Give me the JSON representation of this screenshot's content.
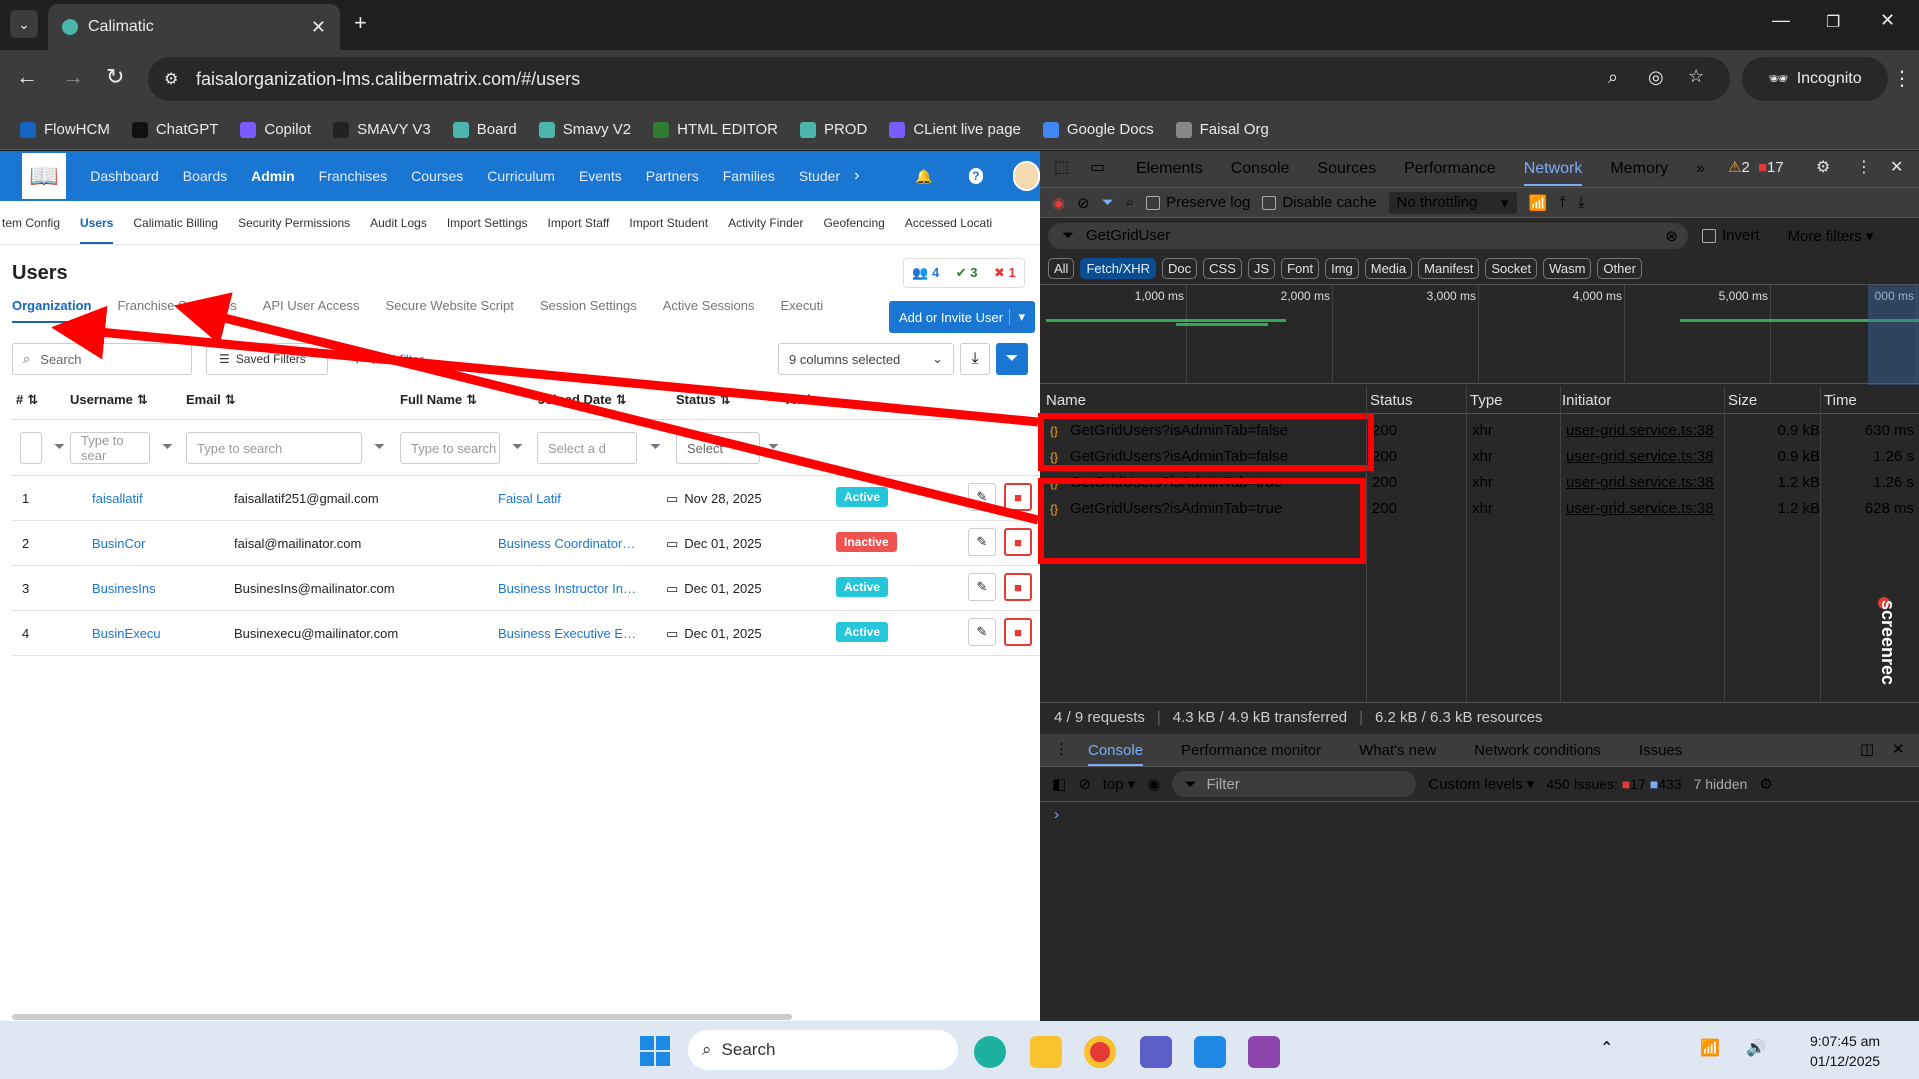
{
  "browser": {
    "tab_title": "Calimatic",
    "url": "faisalorganization-lms.calibermatrix.com/#/users",
    "incognito_label": "Incognito",
    "bookmarks": [
      {
        "label": "FlowHCM",
        "color": "#1565c0"
      },
      {
        "label": "ChatGPT",
        "color": "#111111"
      },
      {
        "label": "Copilot",
        "color": "#7b5cff"
      },
      {
        "label": "SMAVY V3",
        "color": "#222222"
      },
      {
        "label": "Board",
        "color": "#4db6ac"
      },
      {
        "label": "Smavy V2",
        "color": "#4db6ac"
      },
      {
        "label": "HTML EDITOR",
        "color": "#2e7d32"
      },
      {
        "label": "PROD",
        "color": "#4db6ac"
      },
      {
        "label": "CLient live page",
        "color": "#7b5cff"
      },
      {
        "label": "Google Docs",
        "color": "#4285f4"
      },
      {
        "label": "Faisal Org",
        "color": "#888888"
      }
    ]
  },
  "app": {
    "nav": [
      "Dashboard",
      "Boards",
      "Admin",
      "Franchises",
      "Courses",
      "Curriculum",
      "Events",
      "Partners",
      "Families",
      "Studer"
    ],
    "nav_active": "Admin",
    "subnav": [
      "tem Config",
      "Users",
      "Calimatic Billing",
      "Security Permissions",
      "Audit Logs",
      "Import Settings",
      "Import Staff",
      "Import Student",
      "Activity Finder",
      "Geofencing",
      "Accessed Locati"
    ],
    "subnav_active": "Users",
    "page_title": "Users",
    "counts": {
      "total": "4",
      "active": "3",
      "inactive": "1"
    },
    "tabs": [
      "Organization",
      "Franchise S",
      "oles",
      "API User Access",
      "Secure Website Script",
      "Session Settings",
      "Active Sessions",
      "Executi"
    ],
    "invite_button": "Add or Invite User",
    "search_placeholder": "Search",
    "saved_filters": "Saved Filters",
    "add_filter": "Add filter",
    "columns_selected": "9 columns selected",
    "columns": [
      "#",
      "Username",
      "Email",
      "Full Name",
      "Joined Date",
      "Status",
      "Action"
    ],
    "filter_placeholders": {
      "username": "Type to sear",
      "email": "Type to search",
      "fullname": "Type to search",
      "date": "Select a d",
      "status": "Select"
    },
    "rows": [
      {
        "n": "1",
        "username": "faisallatif",
        "email": "faisallatif251@gmail.com",
        "fullname": "Faisal Latif",
        "date": "Nov 28, 2025",
        "status": "Active"
      },
      {
        "n": "2",
        "username": "BusinCor",
        "email": "faisal@mailinator.com",
        "fullname": "Business Coordinator…",
        "date": "Dec 01, 2025",
        "status": "Inactive"
      },
      {
        "n": "3",
        "username": "BusinesIns",
        "email": "BusinesIns@mailinator.com",
        "fullname": "Business Instructor In…",
        "date": "Dec 01, 2025",
        "status": "Active"
      },
      {
        "n": "4",
        "username": "BusinExecu",
        "email": "Businexecu@mailinator.com",
        "fullname": "Business Executive E…",
        "date": "Dec 01, 2025",
        "status": "Active"
      }
    ],
    "colors": {
      "primary": "#1976d2",
      "active": "#26c6da",
      "inactive": "#ef5350"
    }
  },
  "devtools": {
    "tabs": [
      "Elements",
      "Console",
      "Sources",
      "Performance",
      "Network",
      "Memory"
    ],
    "active_tab": "Network",
    "warnings": "2",
    "errors": "17",
    "preserve_log": "Preserve log",
    "disable_cache": "Disable cache",
    "throttling": "No throttling",
    "filter_value": "GetGridUser",
    "invert": "Invert",
    "more_filters": "More filters",
    "types": [
      "All",
      "Fetch/XHR",
      "Doc",
      "CSS",
      "JS",
      "Font",
      "Img",
      "Media",
      "Manifest",
      "Socket",
      "Wasm",
      "Other"
    ],
    "active_type": "Fetch/XHR",
    "timeline": [
      "1,000 ms",
      "2,000 ms",
      "3,000 ms",
      "4,000 ms",
      "5,000 ms",
      "000 ms"
    ],
    "columns": [
      "Name",
      "Status",
      "Type",
      "Initiator",
      "Size",
      "Time"
    ],
    "requests": [
      {
        "name": "GetGridUsers?isAdminTab=false",
        "status": "200",
        "type": "xhr",
        "initiator": "user-grid.service.ts:38",
        "size": "0.9 kB",
        "time": "630 ms"
      },
      {
        "name": "GetGridUsers?isAdminTab=false",
        "status": "200",
        "type": "xhr",
        "initiator": "user-grid.service.ts:38",
        "size": "0.9 kB",
        "time": "1.26 s"
      },
      {
        "name": "GetGridUsers?isAdminTab=true",
        "status": "200",
        "type": "xhr",
        "initiator": "user-grid.service.ts:38",
        "size": "1.2 kB",
        "time": "1.26 s"
      },
      {
        "name": "GetGridUsers?isAdminTab=true",
        "status": "200",
        "type": "xhr",
        "initiator": "user-grid.service.ts:38",
        "size": "1.2 kB",
        "time": "628 ms"
      }
    ],
    "status_bar": [
      "4 / 9 requests",
      "4.3 kB / 4.9 kB transferred",
      "6.2 kB / 6.3 kB resources"
    ],
    "drawer_tabs": [
      "Console",
      "Performance monitor",
      "What's new",
      "Network conditions",
      "Issues"
    ],
    "console_context": "top",
    "console_filter": "Filter",
    "custom_levels": "Custom levels",
    "issues_label": "450 Issues:",
    "issues_errors": "17",
    "issues_info": "433",
    "hidden": "7 hidden",
    "watermark": "screenrec"
  },
  "taskbar": {
    "search": "Search",
    "time": "9:07:45 am",
    "date": "01/12/2025"
  }
}
